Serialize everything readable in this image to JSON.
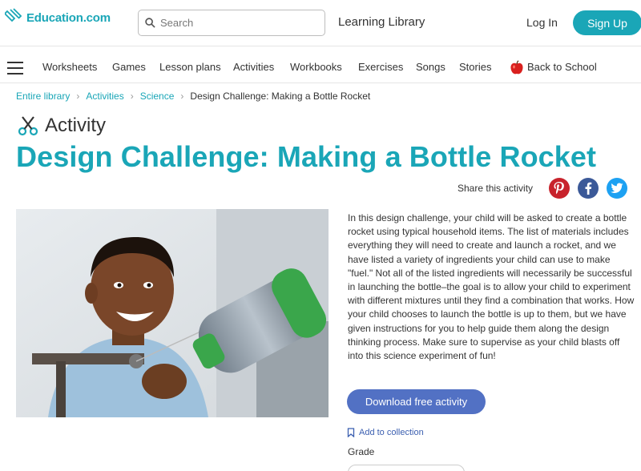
{
  "header": {
    "logo_text": "Education.com",
    "search_placeholder": "Search",
    "learning_library": "Learning Library",
    "login": "Log In",
    "signup": "Sign Up"
  },
  "nav": {
    "items": [
      "Worksheets",
      "Games",
      "Lesson plans",
      "Activities",
      "Workbooks",
      "Exercises",
      "Songs",
      "Stories"
    ],
    "special": "Back to School"
  },
  "breadcrumb": {
    "items": [
      "Entire library",
      "Activities",
      "Science"
    ],
    "current": "Design Challenge: Making a Bottle Rocket"
  },
  "content": {
    "type_label": "Activity",
    "title": "Design Challenge: Making a Bottle Rocket",
    "share_label": "Share this activity",
    "social": [
      "pinterest-icon",
      "facebook-icon",
      "twitter-icon"
    ],
    "description": "In this design challenge, your child will be asked to create a bottle rocket using typical household items. The list of materials includes everything they will need to create and launch a rocket, and we have listed a variety of ingredients your child can use to make \"fuel.\" Not all of the listed ingredients will necessarily be successful in launching the bottle–the goal is to allow your child to experiment with different mixtures until they find a combination that works. How your child chooses to launch the bottle is up to them, but we have given instructions for you to help guide them along the design thinking process. Make sure to supervise as your child blasts off into this science experiment of fun!",
    "download_label": "Download free activity",
    "add_collection": "Add to collection",
    "grade_label": "Grade"
  },
  "colors": {
    "brand_teal": "#1aa6b7",
    "download_blue": "#5271c4",
    "pinterest": "#c8232c",
    "facebook": "#3b5998",
    "twitter": "#1da1f2"
  }
}
